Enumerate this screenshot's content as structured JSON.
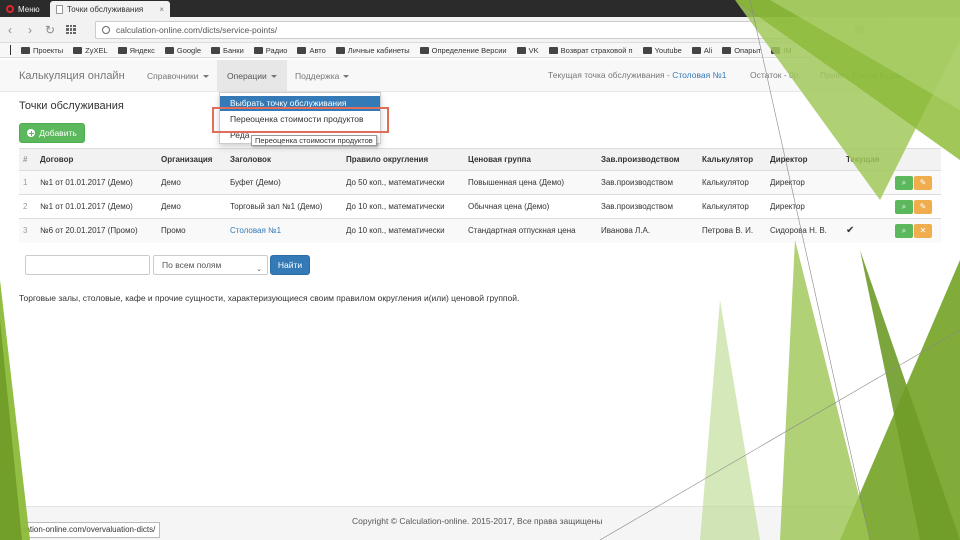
{
  "browser": {
    "menu_label": "Меню",
    "tab_title": "Точки обслуживания",
    "url": "calculation-online.com/dicts/service-points/",
    "bookmarks": [
      "Проекты",
      "ZyXEL",
      "Яндекс",
      "Google",
      "Банки",
      "Радио",
      "Авто",
      "Личные кабинеты",
      "Определение Версии",
      "VK",
      "Возврат страховой п",
      "Youtube",
      "Ali",
      "Опарыт",
      "IM"
    ]
  },
  "nav": {
    "brand": "Калькуляция онлайн",
    "items": [
      "Справочники",
      "Операции",
      "Поддержка"
    ],
    "current_point_label": "Текущая точка обслуживания - ",
    "current_point_link": "Столовая №1",
    "balance": "Остаток - 0р.",
    "greeting": "Привет, Елена Будаило"
  },
  "dropdown": {
    "items": [
      "Выбрать точку обслуживания",
      "Переоценка стоимости продуктов",
      "Реда"
    ],
    "tooltip": "Переоценка стоимости продуктов"
  },
  "page": {
    "title": "Точки обслуживания",
    "add_button": "Добавить"
  },
  "table": {
    "headers": [
      "#",
      "Договор",
      "Организация",
      "Заголовок",
      "Правило округления",
      "Ценовая группа",
      "Зав.производством",
      "Калькулятор",
      "Директор",
      "Текущая"
    ],
    "rows": [
      {
        "num": "1",
        "contract": "№1 от 01.01.2017 (Демо)",
        "org": "Демо",
        "title": "Буфет (Демо)",
        "rounding": "До 50 коп., математически",
        "price_group": "Повышенная цена (Демо)",
        "manager": "Зав.производством",
        "calculator": "Калькулятор",
        "director": "Директор",
        "current": ""
      },
      {
        "num": "2",
        "contract": "№1 от 01.01.2017 (Демо)",
        "org": "Демо",
        "title": "Торговый зал №1 (Демо)",
        "rounding": "До 10 коп., математически",
        "price_group": "Обычная цена (Демо)",
        "manager": "Зав.производством",
        "calculator": "Калькулятор",
        "director": "Директор",
        "current": ""
      },
      {
        "num": "3",
        "contract": "№6 от 20.01.2017 (Промо)",
        "org": "Промо",
        "title": "Столовая №1",
        "rounding": "До 10 коп., математически",
        "price_group": "Стандартная отпускная цена",
        "manager": "Иванова Л.А.",
        "calculator": "Петрова В. И.",
        "director": "Сидорова Н. В.",
        "current": "✔"
      }
    ]
  },
  "search": {
    "input_value": "",
    "select_value": "По всем полям",
    "button": "Найти"
  },
  "description": "Торговые залы, столовые, кафе и прочие сущности, характеризующиеся своим правилом округления и(или) ценовой группой.",
  "footer": "Copyright © Calculation-online. 2015-2017, Все права защищены",
  "status_url": "calculation-online.com/overvaluation-dicts/"
}
